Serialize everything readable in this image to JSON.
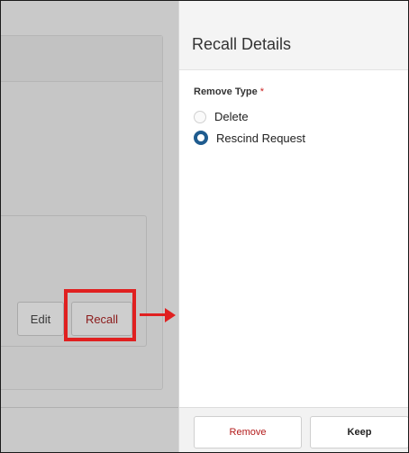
{
  "background": {
    "buttons": {
      "edit_label": "Edit",
      "recall_label": "Recall"
    },
    "annotation_color": "#e02020"
  },
  "panel": {
    "title": "Recall Details",
    "field": {
      "label": "Remove Type",
      "required_mark": "*"
    },
    "options": [
      {
        "label": "Delete",
        "selected": false
      },
      {
        "label": "Rescind Request",
        "selected": true
      }
    ],
    "footer": {
      "remove_label": "Remove",
      "keep_label": "Keep"
    }
  }
}
